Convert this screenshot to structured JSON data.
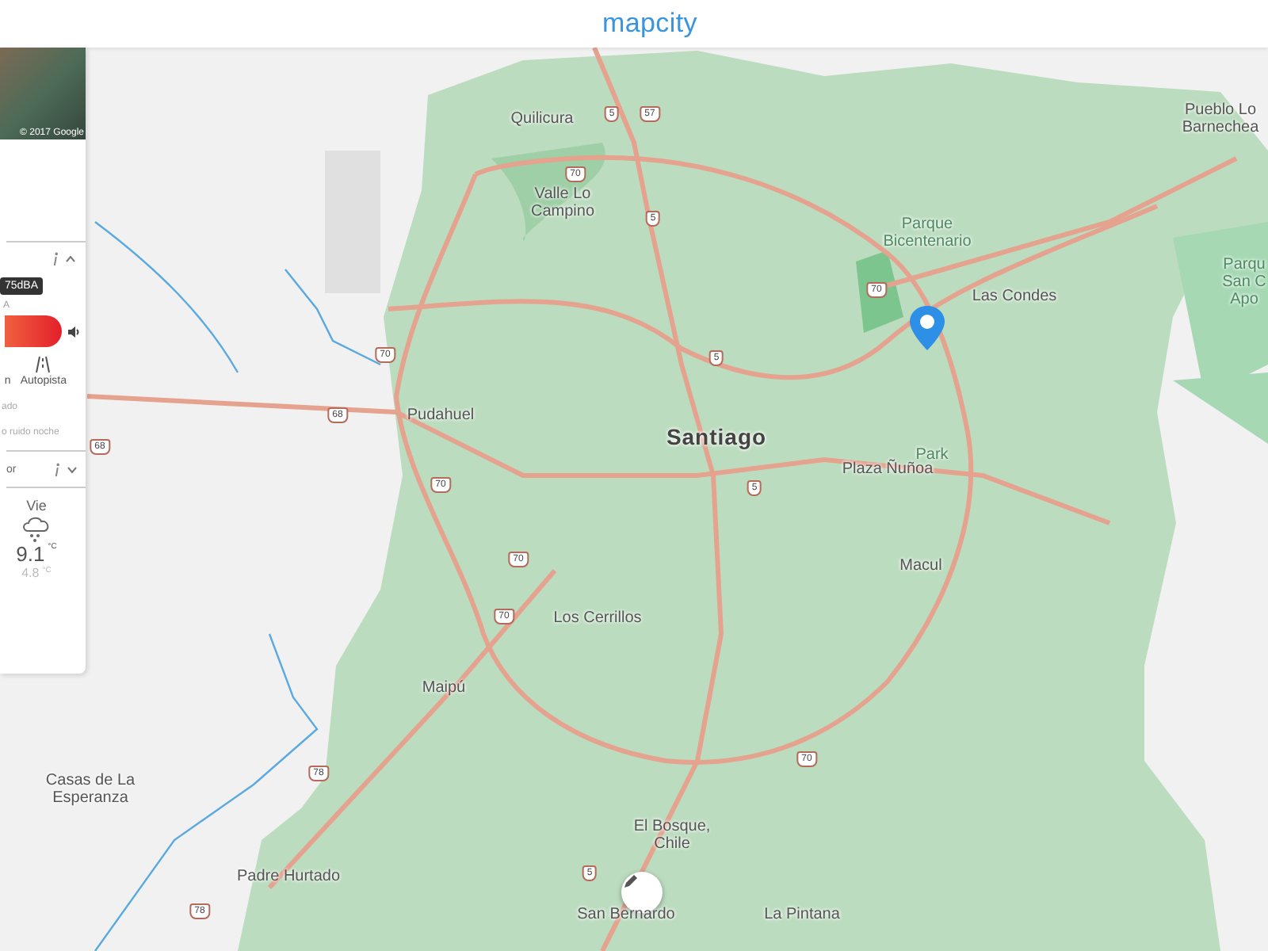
{
  "header": {
    "logo": "mapcity"
  },
  "panel": {
    "photo": {
      "credit": "© 2017 Google"
    },
    "noise": {
      "expanded": true,
      "badge": "75dBA",
      "scale_label": "A",
      "modes": [
        {
          "label": "n",
          "kind": "plain"
        },
        {
          "label": "Autopista",
          "kind": "road"
        }
      ],
      "notes": [
        "ado",
        "o ruido noche"
      ]
    },
    "weather": {
      "title": "or",
      "expanded": false,
      "day": "Vie",
      "high": "9.1",
      "high_unit": "°C",
      "low": "4.8",
      "low_unit": "°C"
    }
  },
  "map": {
    "places": [
      {
        "name": "Quilicura",
        "kind": "district"
      },
      {
        "name": "Valle Lo Campino",
        "kind": "district"
      },
      {
        "name": "Pudahuel",
        "kind": "district"
      },
      {
        "name": "Santiago",
        "kind": "city"
      },
      {
        "name": "Parque Bicentenario",
        "kind": "park"
      },
      {
        "name": "Las Condes",
        "kind": "district"
      },
      {
        "name": "Park",
        "kind": "park"
      },
      {
        "name": "Plaza Ñuñoa",
        "kind": "district"
      },
      {
        "name": "Macul",
        "kind": "district"
      },
      {
        "name": "Los Cerrillos",
        "kind": "district"
      },
      {
        "name": "Maipú",
        "kind": "district"
      },
      {
        "name": "Casas de La Esperanza",
        "kind": "district"
      },
      {
        "name": "Padre Hurtado",
        "kind": "district"
      },
      {
        "name": "El Bosque, Chile",
        "kind": "district"
      },
      {
        "name": "San Bernardo",
        "kind": "district"
      },
      {
        "name": "La Pintana",
        "kind": "district"
      },
      {
        "name": "Pueblo Lo Barnechea",
        "kind": "district"
      },
      {
        "name": "Parqu San C Apo",
        "kind": "park"
      }
    ],
    "route_shields": [
      "5",
      "57",
      "70",
      "5",
      "70",
      "5",
      "70",
      "68",
      "70",
      "5",
      "70",
      "70",
      "70",
      "78",
      "78",
      "5",
      "68"
    ]
  }
}
